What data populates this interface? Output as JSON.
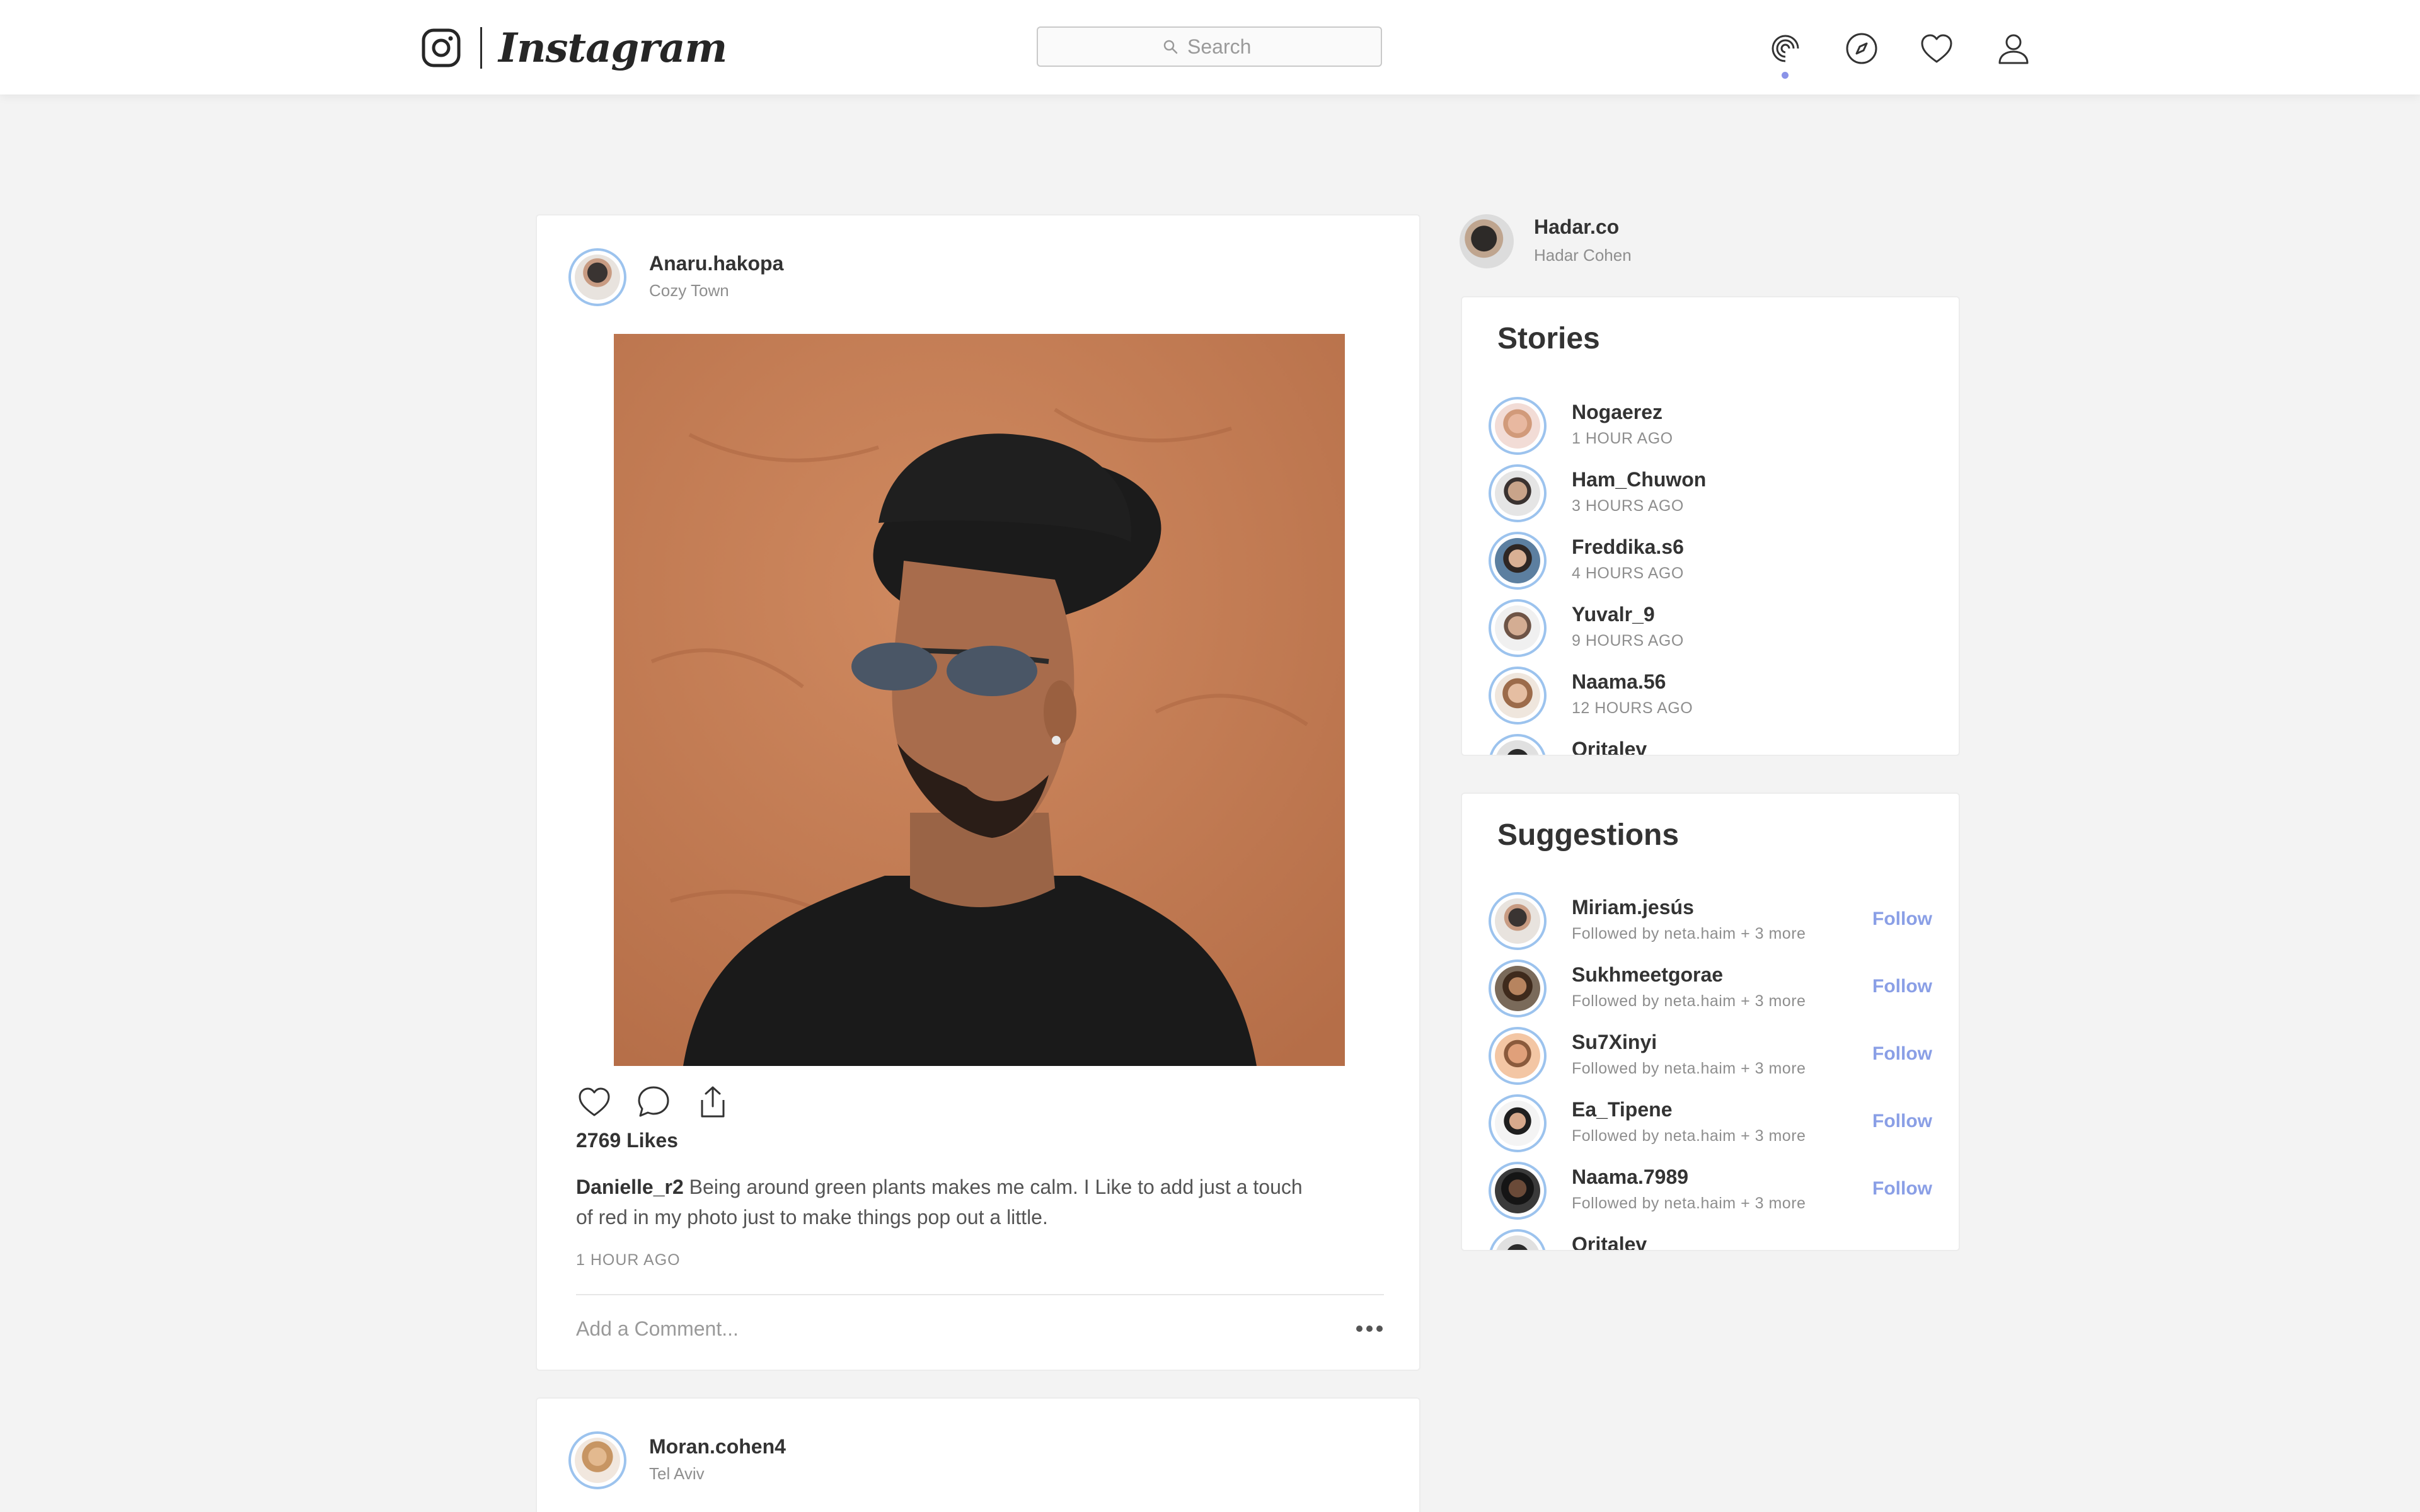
{
  "header": {
    "brand": "Instagram",
    "search_placeholder": "Search"
  },
  "post": {
    "username": "Anaru.hakopa",
    "location": "Cozy Town",
    "likes": "2769 Likes",
    "caption_user": "Danielle_r2",
    "caption_text": " Being around green plants makes me calm. I Like to add just a touch of red in my photo just to make things pop out a little.",
    "time": "1 HOUR AGO",
    "comment_placeholder": "Add a Comment..."
  },
  "post2": {
    "username": "Moran.cohen4",
    "location": "Tel Aviv"
  },
  "me": {
    "username": "Hadar.co",
    "name": "Hadar Cohen"
  },
  "stories": {
    "title": "Stories",
    "items": [
      {
        "user": "Nogaerez",
        "time": "1 HOUR AGO"
      },
      {
        "user": "Ham_Chuwon",
        "time": "3 HOURS AGO"
      },
      {
        "user": "Freddika.s6",
        "time": "4 HOURS AGO"
      },
      {
        "user": "Yuvalr_9",
        "time": "9 HOURS AGO"
      },
      {
        "user": "Naama.56",
        "time": "12 HOURS AGO"
      },
      {
        "user": "Oritalev",
        "time": ""
      }
    ]
  },
  "suggestions": {
    "title": "Suggestions",
    "follow_label": "Follow",
    "items": [
      {
        "user": "Miriam.jesús",
        "sub": "Followed by neta.haim + 3 more"
      },
      {
        "user": "Sukhmeetgorae",
        "sub": "Followed by neta.haim + 3 more"
      },
      {
        "user": "Su7Xinyi",
        "sub": "Followed by neta.haim + 3 more"
      },
      {
        "user": "Ea_Tipene",
        "sub": "Followed by neta.haim + 3 more"
      },
      {
        "user": "Naama.7989",
        "sub": "Followed by neta.haim + 3 more"
      },
      {
        "user": "Oritalev",
        "sub": ""
      }
    ]
  },
  "colors": {
    "accent": "#8a9fe6",
    "avatar_ring": "#9cc3ee",
    "background": "#f3f3f3"
  }
}
